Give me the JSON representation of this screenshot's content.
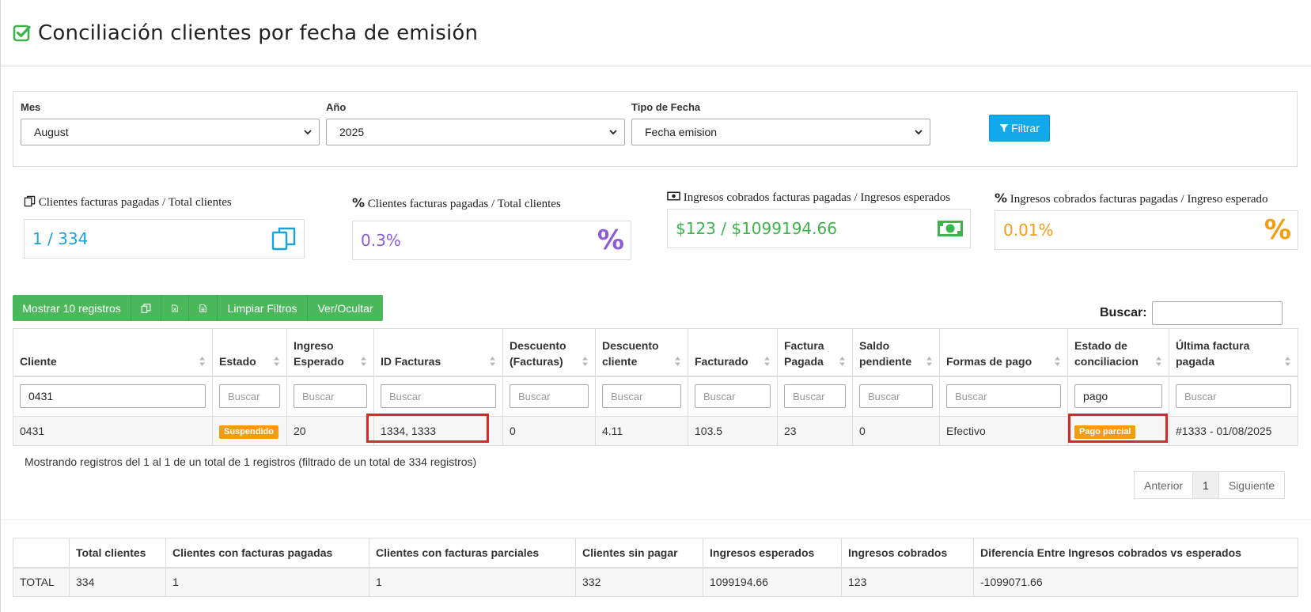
{
  "header": {
    "title": "Conciliación clientes por fecha de emisión"
  },
  "filters": {
    "mes": {
      "label": "Mes",
      "value": "August"
    },
    "anio": {
      "label": "Año",
      "value": "2025"
    },
    "tipo_fecha": {
      "label": "Tipo de Fecha",
      "value": "Fecha emision"
    },
    "filtrar_label": "Filtrar"
  },
  "stats": [
    {
      "title": "Clientes facturas pagadas / Total clientes",
      "value": "1 / 334",
      "color": "#1aa3d9",
      "icon": "copy-icon"
    },
    {
      "title": "Clientes facturas pagadas / Total clientes",
      "value": "0.3%",
      "color": "#8b5cd6",
      "icon": "percent-icon"
    },
    {
      "title": "Ingresos cobrados facturas pagadas / Ingresos esperados",
      "value": "$123 / $1099194.66",
      "color": "#3cb44b",
      "icon": "money-icon"
    },
    {
      "title": "Ingresos cobrados facturas pagadas / Ingreso esperado",
      "value": "0.01%",
      "color": "#f39c12",
      "icon": "percent-icon"
    }
  ],
  "toolbar": {
    "mostrar_label": "Mostrar 10 registros",
    "limpiar_label": "Limpiar Filtros",
    "ver_label": "Ver/Ocultar"
  },
  "search": {
    "label": "Buscar:"
  },
  "table": {
    "columns": [
      "Cliente",
      "Estado",
      "Ingreso Esperado",
      "ID Facturas",
      "Descuento (Facturas)",
      "Descuento cliente",
      "Facturado",
      "Factura Pagada",
      "Saldo pendiente",
      "Formas de pago",
      "Estado de conciliacion",
      "Última factura pagada"
    ],
    "filters": [
      "0431",
      "Buscar",
      "Buscar",
      "Buscar",
      "Buscar",
      "Buscar",
      "Buscar",
      "Buscar",
      "Buscar",
      "Buscar",
      "pago",
      "Buscar"
    ],
    "rows": [
      [
        "0431",
        "Suspendido",
        "20",
        "1334, 1333",
        "0",
        "4.11",
        "103.5",
        "23",
        "0",
        "Efectivo",
        "Pago parcial",
        "#1333 - 01/08/2025"
      ]
    ]
  },
  "colors": {
    "badge_orange": "#f39c12",
    "green": "#4cb85c",
    "blue": "#11a9e9",
    "highlight_red": "#d42a2a"
  },
  "info": "Mostrando registros del 1 al 1 de un total de 1 registros (filtrado de un total de 334 registros)",
  "pagination": {
    "prev": "Anterior",
    "current": "1",
    "next": "Siguiente"
  },
  "totals": {
    "columns": [
      "",
      "Total clientes",
      "Clientes con facturas pagadas",
      "Clientes con facturas parciales",
      "Clientes sin pagar",
      "Ingresos esperados",
      "Ingresos cobrados",
      "Diferencia Entre Ingresos cobrados vs esperados"
    ],
    "row": [
      "TOTAL",
      "334",
      "1",
      "1",
      "332",
      "1099194.66",
      "123",
      "-1099071.66"
    ]
  }
}
